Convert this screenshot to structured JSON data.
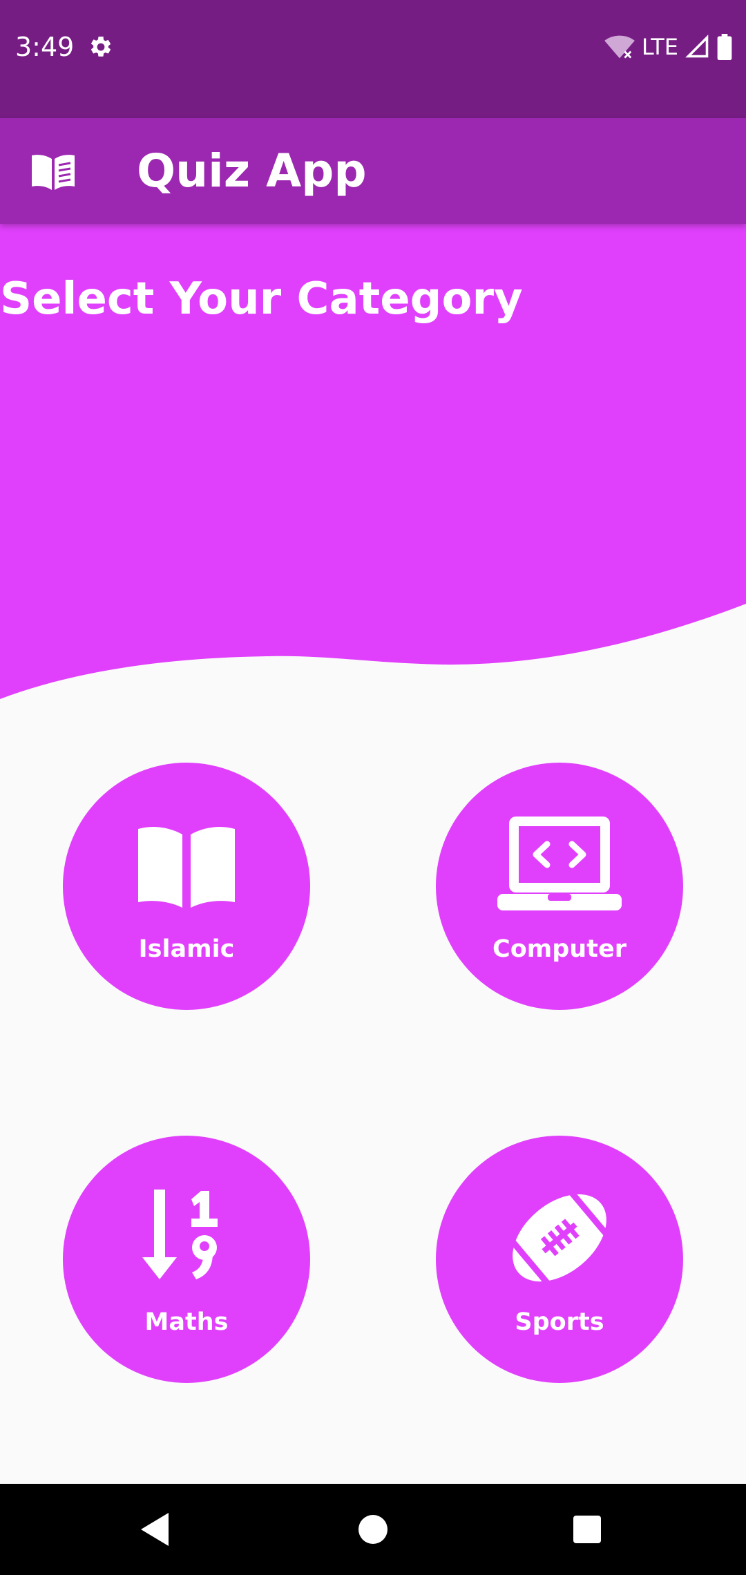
{
  "status_bar": {
    "time": "3:49",
    "network": "LTE",
    "icons": [
      "settings-icon",
      "wifi-off-icon",
      "signal-icon",
      "battery-icon"
    ]
  },
  "app_bar": {
    "title": "Quiz App",
    "icon": "book-open-icon"
  },
  "hero": {
    "title": "Select Your Category"
  },
  "categories": [
    {
      "label": "Islamic",
      "icon": "open-book-icon"
    },
    {
      "label": "Computer",
      "icon": "laptop-code-icon"
    },
    {
      "label": "Maths",
      "icon": "sort-numeric-down-icon"
    },
    {
      "label": "Sports",
      "icon": "football-icon"
    }
  ],
  "nav_bar": {
    "buttons": [
      "back-icon",
      "home-icon",
      "recents-icon"
    ]
  },
  "colors": {
    "status_bar": "#761d84",
    "app_bar": "#9c27b0",
    "accent": "#e040fb",
    "background": "#fafafa"
  }
}
